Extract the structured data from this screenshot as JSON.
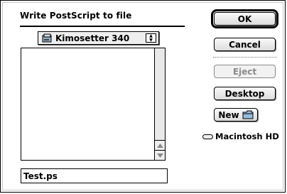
{
  "dialog": {
    "title": "Write PostScript to file"
  },
  "location_popup": {
    "label": "Kimosetter 340",
    "icon": "volume-icon"
  },
  "file_list": {
    "items": []
  },
  "filename_field": {
    "value": "Test.ps"
  },
  "buttons": {
    "ok": "OK",
    "cancel": "Cancel",
    "eject": "Eject",
    "desktop": "Desktop",
    "new": "New"
  },
  "volume": {
    "name": "Macintosh HD",
    "icon": "hard-drive-icon"
  }
}
